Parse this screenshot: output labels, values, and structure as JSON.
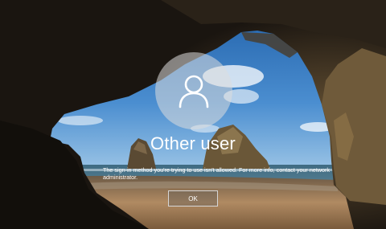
{
  "user": {
    "display_name": "Other user",
    "avatar_icon": "user-icon"
  },
  "alert": {
    "message": "The sign-in method you're trying to use isn't allowed. For more info, contact your network administrator.",
    "ok_label": "OK"
  },
  "theme": {
    "text_color": "#ffffff",
    "button_border": "#d6d6d6"
  }
}
